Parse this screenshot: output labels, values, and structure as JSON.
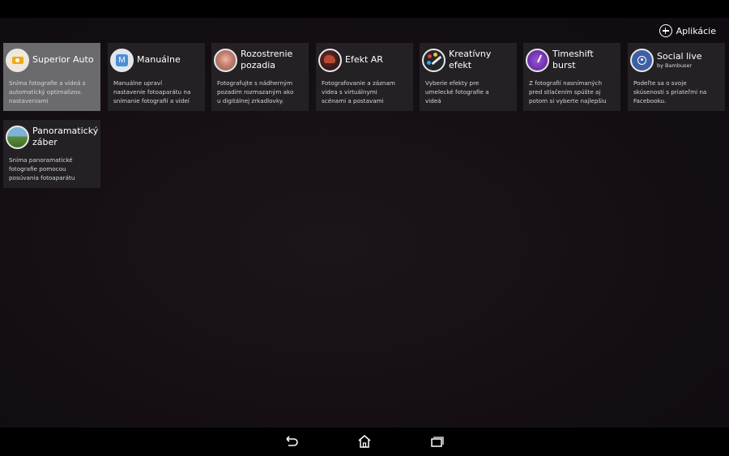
{
  "header": {
    "apps_label": "Aplikácie",
    "apps_icon": "plus-circle-icon"
  },
  "tiles": [
    {
      "title": "Superior Auto",
      "subtitle": "",
      "icon": "superior-auto-camera-icon",
      "selected": true,
      "desc": [
        "Sníma fotografie a videá s",
        "automatický optimalizov.",
        "nastaveniami"
      ]
    },
    {
      "title": "Manuálne",
      "subtitle": "",
      "icon": "manual-m-icon",
      "selected": false,
      "desc": [
        "Manuálne upraví",
        "nastavenie fotoaparátu na",
        "snímanie fotografií a videí"
      ]
    },
    {
      "title_lines": [
        "Rozostrenie",
        "pozadia"
      ],
      "icon": "background-defocus-icon",
      "selected": false,
      "desc": [
        "Fotografujte s nádherným",
        "pozadím rozmazaným ako",
        "u digitálnej zrkadlovky."
      ]
    },
    {
      "title": "Efekt AR",
      "subtitle": "",
      "icon": "ar-effect-icon",
      "selected": false,
      "desc": [
        "Fotografovanie a záznam",
        "videa s virtuálnymi",
        "scénami a postavami"
      ]
    },
    {
      "title": "Kreatívny efekt",
      "subtitle": "",
      "icon": "creative-effect-icon",
      "selected": false,
      "desc": [
        "Vyberie efekty pre",
        "umelecké fotografie a",
        "videá"
      ]
    },
    {
      "title": "Timeshift burst",
      "subtitle": "",
      "icon": "timeshift-burst-icon",
      "selected": false,
      "desc": [
        "Z fotografií nasnímaných",
        "pred stlačením spúšte aj",
        "potom si vyberte najlepšiu"
      ]
    },
    {
      "title": "Social live",
      "subtitle": "by Bambuser",
      "icon": "social-live-icon",
      "selected": false,
      "desc": [
        "Podeľte sa o svoje",
        "skúsenosti s priateľmi na",
        "Facebooku."
      ]
    },
    {
      "title_lines": [
        "Panoramatický",
        "záber"
      ],
      "icon": "panorama-icon",
      "selected": false,
      "desc": [
        "Sníma panoramatické",
        "fotografie pomocou",
        "posúvania fotoaparátu"
      ]
    }
  ],
  "navbar": {
    "back_icon": "back-icon",
    "home_icon": "home-icon",
    "recents_icon": "recent-apps-icon"
  },
  "colors": {
    "tile_bg": "#242124",
    "tile_selected_bg": "#6b6a6c",
    "background": "#150f15"
  }
}
